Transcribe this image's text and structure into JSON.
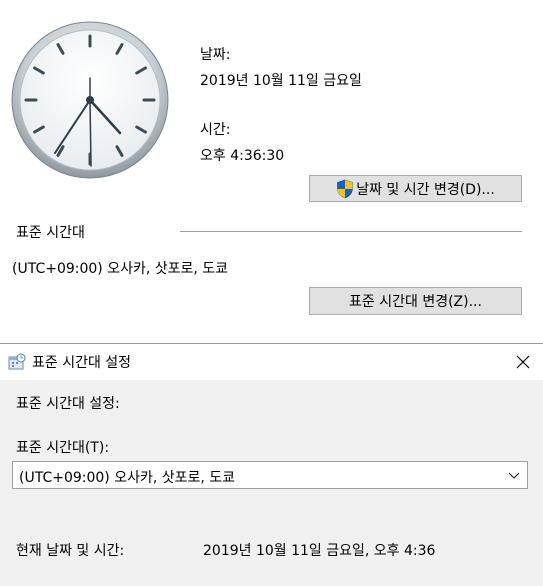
{
  "datetime": {
    "date_label": "날짜:",
    "date_value": "2019년 10월 11일 금요일",
    "time_label": "시간:",
    "time_value": "오후 4:36:30",
    "change_button": "날짜 및 시간 변경(D)...",
    "shield_icon": "uac-shield-icon"
  },
  "timezone": {
    "section_label": "표준 시간대",
    "value": "(UTC+09:00) 오사카, 삿포로, 도쿄",
    "change_button": "표준 시간대 변경(Z)..."
  },
  "dialog": {
    "title": "표준 시간대 설정",
    "heading": "표준 시간대 설정:",
    "tz_label": "표준 시간대(T):",
    "tz_selected": "(UTC+09:00) 오사카, 삿포로, 도쿄",
    "current_label": "현재 날짜 및 시간:",
    "current_value": "2019년 10월 11일 금요일, 오후 4:36",
    "close_icon": "close-icon"
  },
  "colors": {
    "button_bg": "#e1e1e1",
    "dialog_bg": "#f0f0f0",
    "border": "#adadad"
  }
}
